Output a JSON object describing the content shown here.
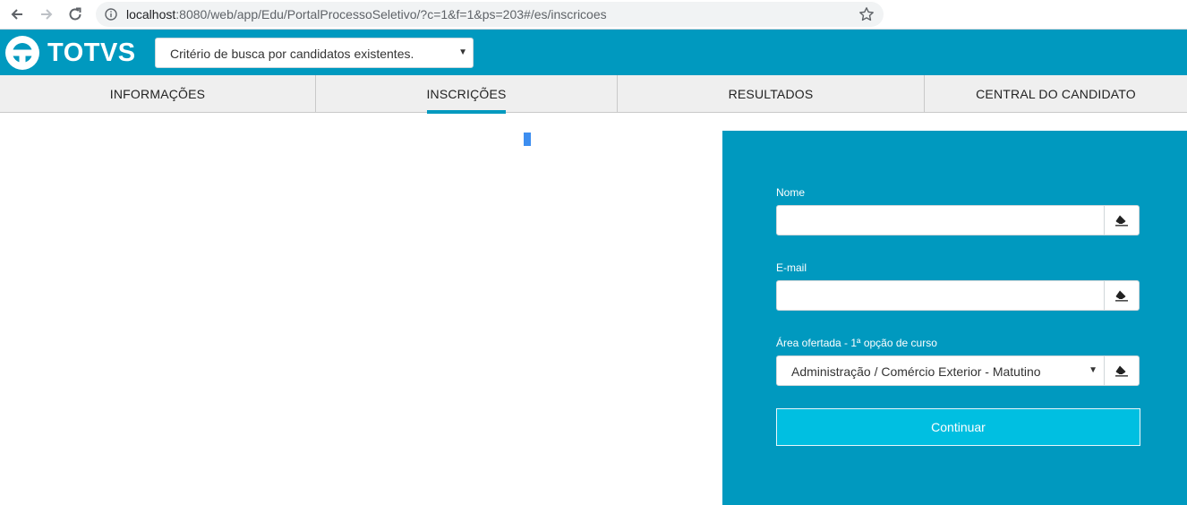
{
  "browser": {
    "url_host": "localhost",
    "url_rest": ":8080/web/app/Edu/PortalProcessoSeletivo/?c=1&f=1&ps=203#/es/inscricoes"
  },
  "header": {
    "logo_text": "TOTVS",
    "search_criteria": "Critério de busca por candidatos existentes.",
    "brand_color": "#0099bf"
  },
  "tabs": [
    {
      "label": "INFORMAÇÕES"
    },
    {
      "label": "INSCRIÇÕES",
      "active": true
    },
    {
      "label": "RESULTADOS"
    },
    {
      "label": "CENTRAL DO CANDIDATO"
    }
  ],
  "form": {
    "name_label": "Nome",
    "name_value": "",
    "email_label": "E-mail",
    "email_value": "",
    "area_label": "Área ofertada - 1ª opção de curso",
    "area_selected": "Administração / Comércio Exterior - Matutino",
    "continue_label": "Continuar",
    "clear_icon": "eraser-icon"
  }
}
